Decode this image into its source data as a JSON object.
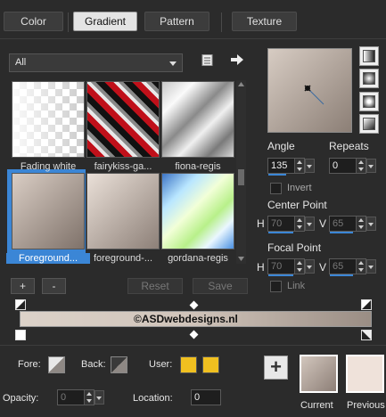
{
  "tabs": [
    "Color",
    "Gradient",
    "Pattern",
    "Texture"
  ],
  "active_tab": "Gradient",
  "filter": {
    "value": "All"
  },
  "gallery": [
    {
      "label": "Fading white"
    },
    {
      "label": "fairykiss-ga..."
    },
    {
      "label": "fiona-regis"
    },
    {
      "label": "Foreground..."
    },
    {
      "label": "foreground-..."
    },
    {
      "label": "gordana-regis"
    }
  ],
  "buttons": {
    "add": "+",
    "remove": "-",
    "reset": "Reset",
    "save": "Save"
  },
  "angle": {
    "label": "Angle",
    "value": "135"
  },
  "repeats": {
    "label": "Repeats",
    "value": "0"
  },
  "invert": {
    "label": "Invert",
    "checked": false
  },
  "center_point": {
    "label": "Center Point",
    "h_label": "H",
    "h_value": "70",
    "v_label": "V",
    "v_value": "65"
  },
  "focal_point": {
    "label": "Focal Point",
    "h_label": "H",
    "h_value": "70",
    "v_label": "V",
    "v_value": "65"
  },
  "link": {
    "label": "Link"
  },
  "gradient_bar": {
    "watermark": "©ASDwebdesigns.nl"
  },
  "fore": {
    "label": "Fore:"
  },
  "back": {
    "label": "Back:"
  },
  "user": {
    "label": "User:"
  },
  "opacity": {
    "label": "Opacity:",
    "value": "0"
  },
  "location": {
    "label": "Location:",
    "value": "0"
  },
  "current": {
    "label": "Current",
    "color": "#b0a29a"
  },
  "previous": {
    "label": "Previous",
    "color": "#efe2da"
  },
  "colors": {
    "accent": "#3b86d6",
    "user_swatch": "#f0c020"
  }
}
